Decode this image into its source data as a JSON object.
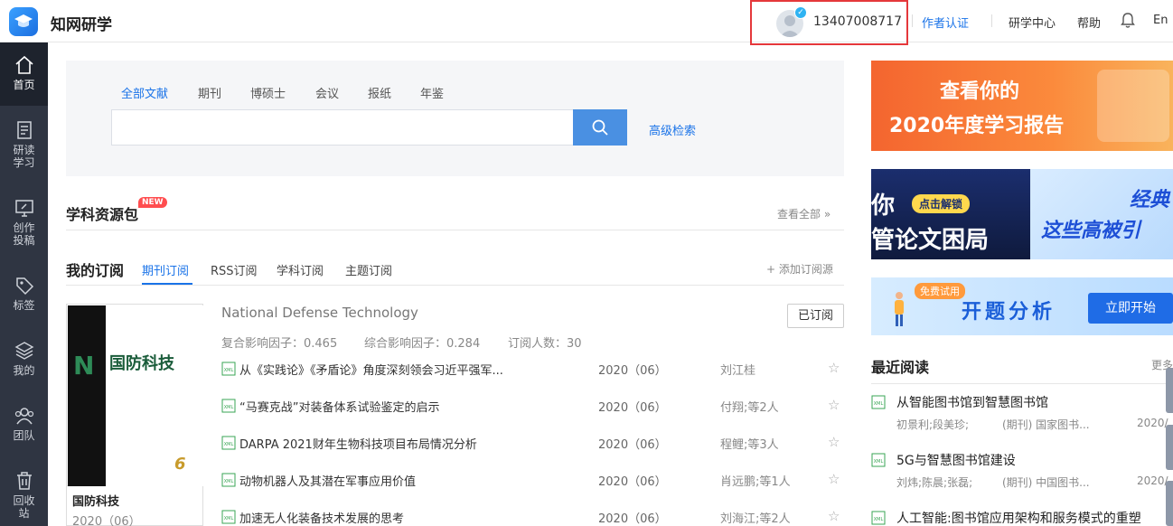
{
  "app": {
    "title": "知网研学"
  },
  "header": {
    "phone": "13407008717",
    "author_cert": "作者认证",
    "research_center": "研学中心",
    "help": "帮助",
    "lang": "En"
  },
  "sidebar": {
    "items": [
      {
        "label": "首页",
        "icon": "home-icon"
      },
      {
        "label": "研读学习",
        "icon": "document-icon"
      },
      {
        "label": "创作投稿",
        "icon": "monitor-edit-icon"
      },
      {
        "label": "标签",
        "icon": "tag-icon"
      },
      {
        "label": "我的",
        "icon": "layers-icon"
      },
      {
        "label": "团队",
        "icon": "team-icon"
      },
      {
        "label": "回收站",
        "icon": "trash-icon"
      }
    ]
  },
  "search": {
    "tabs": [
      "全部文献",
      "期刊",
      "博硕士",
      "会议",
      "报纸",
      "年鉴"
    ],
    "placeholder": "",
    "advanced": "高级检索"
  },
  "resource_pack": {
    "title": "学科资源包",
    "badge": "NEW",
    "view_all": "查看全部"
  },
  "subscriptions": {
    "title": "我的订阅",
    "tabs": [
      "期刊订阅",
      "RSS订阅",
      "学科订阅",
      "主题订阅"
    ],
    "add": "添加订阅源",
    "journal": {
      "name_en": "National Defense Technology",
      "name_cn": "国防科技",
      "cover_year": "2020（06）",
      "subscribed": "已订阅",
      "impact_composite": "复合影响因子：0.465",
      "impact_comprehensive": "综合影响因子：0.284",
      "subscribers": "订阅人数：30",
      "cover_issue": "6",
      "cover_letter": "N"
    },
    "articles": [
      {
        "title": "从《实践论》《矛盾论》角度深刻领会习近平强军...",
        "issue": "2020（06）",
        "author": "刘江桂"
      },
      {
        "title": "“马赛克战”对装备体系试验鉴定的启示",
        "issue": "2020（06）",
        "author": "付翔;等2人"
      },
      {
        "title": "DARPA 2021财年生物科技项目布局情况分析",
        "issue": "2020（06）",
        "author": "程鲤;等3人"
      },
      {
        "title": "动物机器人及其潜在军事应用价值",
        "issue": "2020（06）",
        "author": "肖远鹏;等1人"
      },
      {
        "title": "加速无人化装备技术发展的思考",
        "issue": "2020（06）",
        "author": "刘海江;等2人"
      }
    ]
  },
  "banners": {
    "report_line1": "查看你的",
    "report_line2": "2020年度学习报告",
    "unlock_left1": "你",
    "unlock_pill": "点击解锁",
    "unlock_left2": "管论文困局",
    "unlock_right1": "经典",
    "unlock_right2": "这些高被引",
    "proposal_free": "免费试用",
    "proposal_title": "开题分析",
    "proposal_go": "立即开始"
  },
  "recent": {
    "title": "最近阅读",
    "more": "更多",
    "items": [
      {
        "title": "从智能图书馆到智慧图书馆",
        "authors": "初景利;段美珍;",
        "source": "(期刊) 国家图书...",
        "date": "2020/"
      },
      {
        "title": "5G与智慧图书馆建设",
        "authors": "刘炜;陈晨;张磊;",
        "source": "(期刊) 中国图书...",
        "date": "2020/"
      },
      {
        "title": "人工智能:图书馆应用架构和服务模式的重塑",
        "authors": "",
        "source": "",
        "date": ""
      }
    ]
  },
  "colors": {
    "accent": "#1a73e8",
    "sidebar_bg": "#2f3542",
    "highlight_box": "#e5383b"
  }
}
